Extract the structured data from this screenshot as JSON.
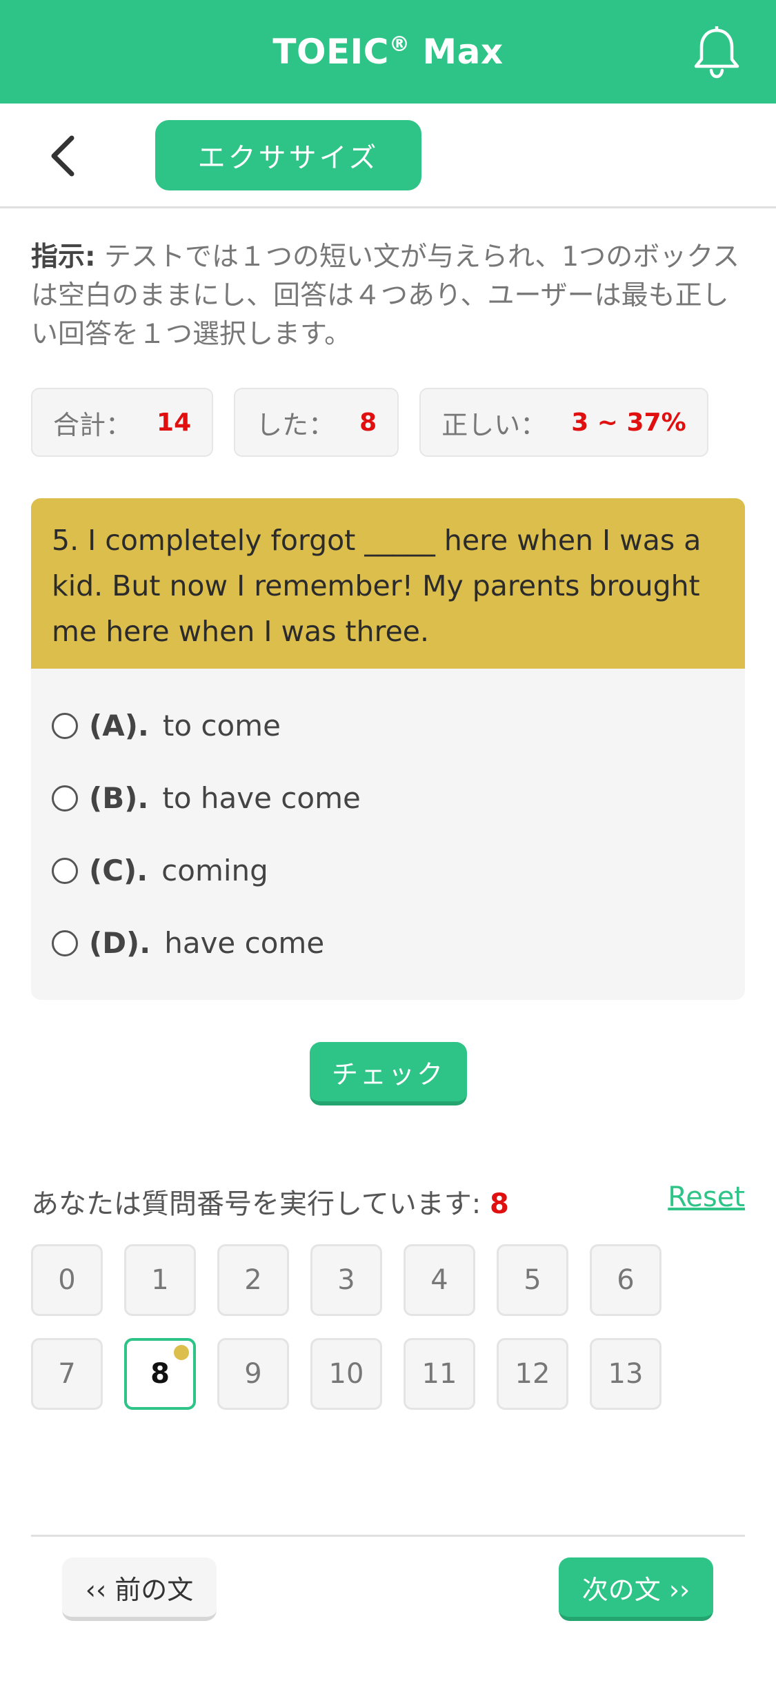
{
  "app": {
    "title": "TOEIC",
    "title_sup": "®",
    "title_suffix": " Max"
  },
  "subbar": {
    "exercise_label": "エクササイズ"
  },
  "instructions": {
    "label": "指示:",
    "text": " テストでは１つの短い文が与えられ、1つのボックスは空白のままにし、回答は４つあり、ユーザーは最も正しい回答を１つ選択します。"
  },
  "stats": {
    "total_label": "合計：",
    "total_value": "14",
    "done_label": "した：",
    "done_value": "8",
    "correct_label": "正しい：",
    "correct_value": "3 ~ 37%"
  },
  "question": {
    "text": "5. I completely forgot _____ here when I was a kid. But now I remember! My parents brought me here when I was three.",
    "options": [
      {
        "letter": "(A).",
        "text": "to come"
      },
      {
        "letter": "(B).",
        "text": "to have come"
      },
      {
        "letter": "(C).",
        "text": "coming"
      },
      {
        "letter": "(D).",
        "text": "have come"
      }
    ]
  },
  "check_label": "チェック",
  "progress": {
    "running_label": "あなたは質問番号を実行しています: ",
    "current_number": "8",
    "reset_label": "Reset",
    "numbers": [
      "0",
      "1",
      "2",
      "3",
      "4",
      "5",
      "6",
      "7",
      "8",
      "9",
      "10",
      "11",
      "12",
      "13"
    ]
  },
  "nav": {
    "prev_label": "‹‹ 前の文",
    "next_label": "次の文 ››"
  },
  "colors": {
    "brand": "#2ec487",
    "question_bg": "#dcbe4d",
    "accent_red": "#e01010"
  },
  "icons": {
    "bell": "bell-icon",
    "back": "chevron-left-icon"
  }
}
